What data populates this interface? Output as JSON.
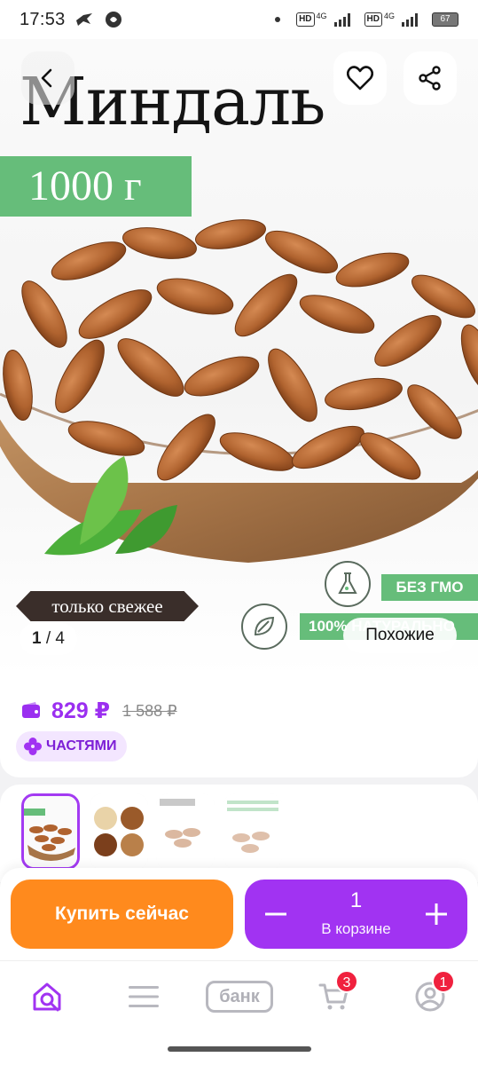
{
  "status_bar": {
    "time": "17:53",
    "battery": "67",
    "network_left": "4G",
    "network_right": "4G"
  },
  "product": {
    "title": "Миндаль",
    "weight": "1000 г",
    "fresh_label": "только свежее",
    "badge_gmo": "БЕЗ ГМО",
    "badge_natural": "100% НАТУРАЛЬНО",
    "image_counter_current": "1",
    "image_counter_total": "4",
    "similar_label": "Похожие"
  },
  "price": {
    "current": "829 ₽",
    "old": "1 588 ₽",
    "installment_label": "ЧАСТЯМИ"
  },
  "actions": {
    "buy_now_label": "Купить сейчас",
    "cart_quantity": "1",
    "cart_label": "В корзине"
  },
  "bottom_nav": {
    "bank_label": "банк",
    "cart_count": "3",
    "profile_count": "1"
  },
  "colors": {
    "accent": "#a133f2",
    "buy": "#ff8a1d",
    "price": "#9b2ff0",
    "green": "#66bd7a",
    "badge": "#f0213e"
  }
}
